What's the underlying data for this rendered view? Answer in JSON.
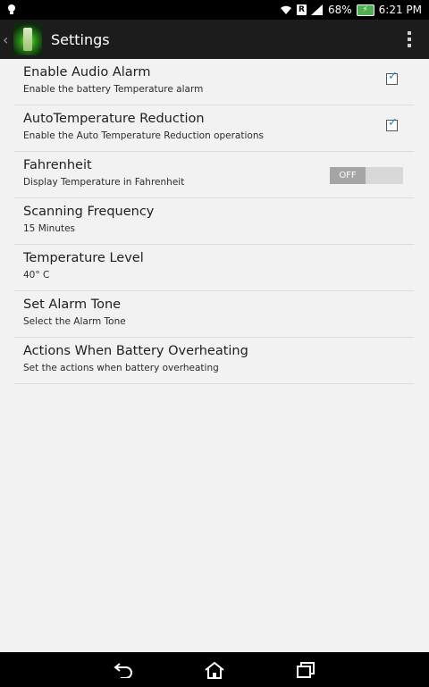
{
  "status_bar": {
    "time": "6:21 PM",
    "battery": "68%",
    "sim_label": "R"
  },
  "action_bar": {
    "title": "Settings"
  },
  "settings": [
    {
      "title": "Enable Audio Alarm",
      "summary": "Enable the battery Temperature alarm",
      "control": "checkbox",
      "checked": true
    },
    {
      "title": "AutoTemperature Reduction",
      "summary": "Enable the Auto Temperature Reduction operations",
      "control": "checkbox",
      "checked": true
    },
    {
      "title": "Fahrenheit",
      "summary": "Display Temperature in Fahrenheit",
      "control": "toggle",
      "state": "OFF"
    },
    {
      "title": "Scanning Frequency",
      "summary": "15 Minutes"
    },
    {
      "title": "Temperature Level",
      "summary": "40° C"
    },
    {
      "title": "Set Alarm Tone",
      "summary": "Select the Alarm Tone"
    },
    {
      "title": "Actions When Battery Overheating",
      "summary": "Set the actions when battery overheating"
    }
  ],
  "colors": {
    "accent_check": "#1e88e5",
    "action_bar": "#1c1c1c",
    "background": "#f2f2f2"
  },
  "icons": [
    "notification-lightbulb-icon",
    "wifi-icon",
    "signal-icon",
    "battery-charging-icon",
    "back-icon",
    "home-icon",
    "recent-apps-icon",
    "overflow-menu-icon"
  ]
}
